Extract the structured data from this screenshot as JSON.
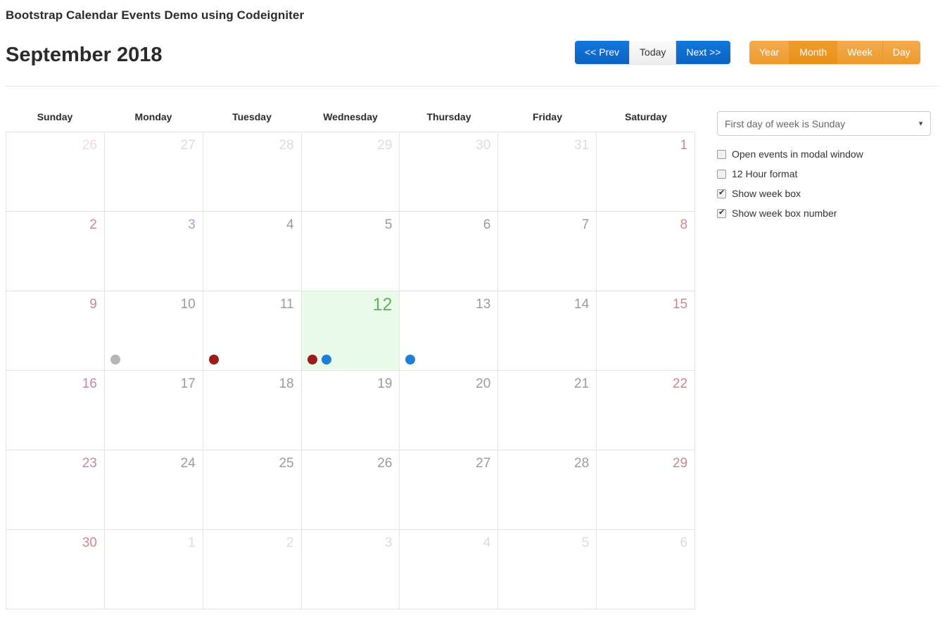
{
  "header": {
    "app_title": "Bootstrap Calendar Events Demo using Codeigniter",
    "month_title": "September 2018"
  },
  "nav_buttons": [
    {
      "label": "<< Prev",
      "style": "blue"
    },
    {
      "label": "Today",
      "style": "light"
    },
    {
      "label": "Next >>",
      "style": "blue"
    }
  ],
  "view_buttons": [
    {
      "label": "Year",
      "active": false
    },
    {
      "label": "Month",
      "active": true
    },
    {
      "label": "Week",
      "active": false
    },
    {
      "label": "Day",
      "active": false
    }
  ],
  "calendar": {
    "day_headers": [
      "Sunday",
      "Monday",
      "Tuesday",
      "Wednesday",
      "Thursday",
      "Friday",
      "Saturday"
    ],
    "weeks": [
      [
        {
          "num": "26",
          "kind": "other-weekend"
        },
        {
          "num": "27",
          "kind": "other"
        },
        {
          "num": "28",
          "kind": "other"
        },
        {
          "num": "29",
          "kind": "other"
        },
        {
          "num": "30",
          "kind": "other"
        },
        {
          "num": "31",
          "kind": "other"
        },
        {
          "num": "1",
          "kind": "weekend"
        }
      ],
      [
        {
          "num": "2",
          "kind": "weekend"
        },
        {
          "num": "3",
          "kind": "visited"
        },
        {
          "num": "4",
          "kind": "normal"
        },
        {
          "num": "5",
          "kind": "normal"
        },
        {
          "num": "6",
          "kind": "normal"
        },
        {
          "num": "7",
          "kind": "normal"
        },
        {
          "num": "8",
          "kind": "weekend"
        }
      ],
      [
        {
          "num": "9",
          "kind": "weekend"
        },
        {
          "num": "10",
          "kind": "normal",
          "events": [
            "grey"
          ]
        },
        {
          "num": "11",
          "kind": "normal",
          "events": [
            "darkred"
          ]
        },
        {
          "num": "12",
          "kind": "today",
          "today": true,
          "events": [
            "darkred",
            "blue"
          ]
        },
        {
          "num": "13",
          "kind": "normal",
          "events": [
            "blue"
          ]
        },
        {
          "num": "14",
          "kind": "normal"
        },
        {
          "num": "15",
          "kind": "weekend"
        }
      ],
      [
        {
          "num": "16",
          "kind": "weekend"
        },
        {
          "num": "17",
          "kind": "normal"
        },
        {
          "num": "18",
          "kind": "normal"
        },
        {
          "num": "19",
          "kind": "normal"
        },
        {
          "num": "20",
          "kind": "normal"
        },
        {
          "num": "21",
          "kind": "normal"
        },
        {
          "num": "22",
          "kind": "weekend"
        }
      ],
      [
        {
          "num": "23",
          "kind": "weekend"
        },
        {
          "num": "24",
          "kind": "normal"
        },
        {
          "num": "25",
          "kind": "normal"
        },
        {
          "num": "26",
          "kind": "normal"
        },
        {
          "num": "27",
          "kind": "normal"
        },
        {
          "num": "28",
          "kind": "normal"
        },
        {
          "num": "29",
          "kind": "weekend"
        }
      ],
      [
        {
          "num": "30",
          "kind": "weekend"
        },
        {
          "num": "1",
          "kind": "other"
        },
        {
          "num": "2",
          "kind": "other"
        },
        {
          "num": "3",
          "kind": "other"
        },
        {
          "num": "4",
          "kind": "other"
        },
        {
          "num": "5",
          "kind": "other"
        },
        {
          "num": "6",
          "kind": "other"
        }
      ]
    ]
  },
  "settings": {
    "first_day_select": {
      "value": "First day of week is Sunday",
      "caret_icon": "chevron-down-icon"
    },
    "options": [
      {
        "label": "Open events in modal window",
        "checked": false
      },
      {
        "label": "12 Hour format",
        "checked": false
      },
      {
        "label": "Show week box",
        "checked": true
      },
      {
        "label": "Show week box number",
        "checked": true
      }
    ]
  },
  "colors": {
    "event_grey": "#b6b6b6",
    "event_darkred": "#9e1b1b",
    "event_blue": "#1d7fd8",
    "today_bg": "#eafbea",
    "today_text": "#64b064",
    "blue_button": "#0d6ecd",
    "orange_button": "#ef9c2d",
    "weekend_text": "#c88a91",
    "weekday_text": "#9b9b9b"
  }
}
